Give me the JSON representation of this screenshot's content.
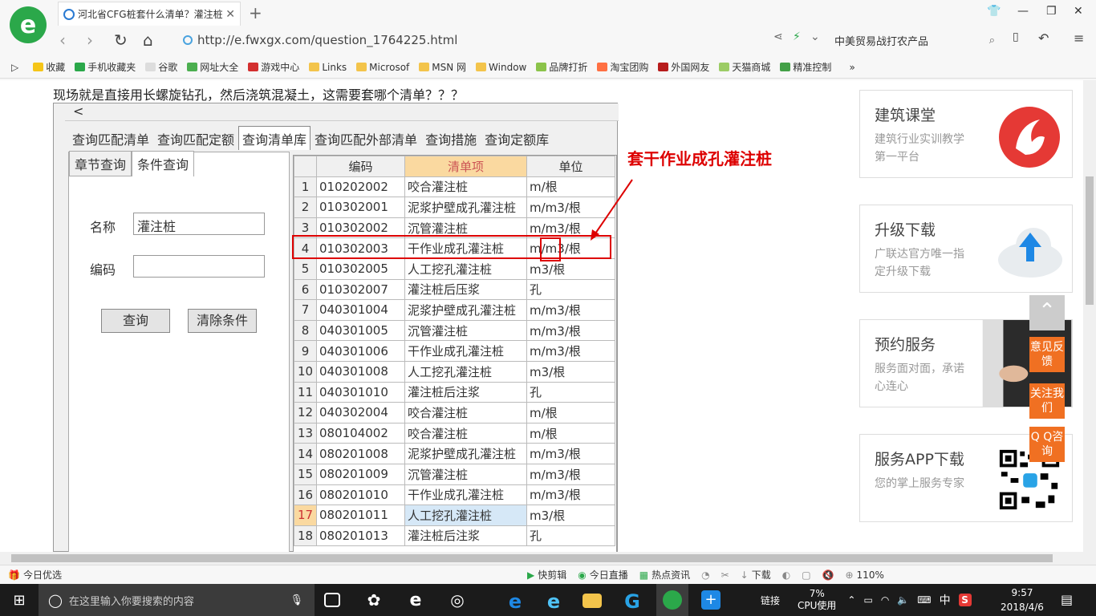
{
  "browser": {
    "tab_title": "河北省CFG桩套什么清单？灌注桩",
    "url": "http://e.fwxgx.com/question_1764225.html",
    "search_text": "中美贸易战打农产品",
    "bookmarks": [
      "收藏",
      "手机收藏夹",
      "谷歌",
      "网址大全",
      "游戏中心",
      "Links",
      "Microsof",
      "MSN 网",
      "Window",
      "品牌打折",
      "淘宝团购",
      "外国网友",
      "天猫商城",
      "精准控制"
    ]
  },
  "page": {
    "question": "现场就是直接用长螺旋钻孔，然后浇筑混凝土，这需要套哪个清单？？？",
    "annotation": "套干作业成孔灌注桩"
  },
  "software": {
    "back_btn": "<",
    "menu_tabs": [
      "查询匹配清单",
      "查询匹配定额",
      "查询清单库",
      "查询匹配外部清单",
      "查询措施",
      "查询定额库"
    ],
    "sub_tabs": [
      "章节查询",
      "条件查询"
    ],
    "name_label": "名称",
    "name_value": "灌注桩",
    "code_label": "编码",
    "code_value": "",
    "query_btn": "查询",
    "clear_btn": "清除条件",
    "headers": [
      "",
      "编码",
      "清单项",
      "单位"
    ],
    "rows": [
      [
        "1",
        "010202002",
        "咬合灌注桩",
        "m/根"
      ],
      [
        "2",
        "010302001",
        "泥浆护壁成孔灌注桩",
        "m/m3/根"
      ],
      [
        "3",
        "010302002",
        "沉管灌注桩",
        "m/m3/根"
      ],
      [
        "4",
        "010302003",
        "干作业成孔灌注桩",
        "m/m3/根"
      ],
      [
        "5",
        "010302005",
        "人工挖孔灌注桩",
        "m3/根"
      ],
      [
        "6",
        "010302007",
        "灌注桩后压浆",
        "孔"
      ],
      [
        "7",
        "040301004",
        "泥浆护壁成孔灌注桩",
        "m/m3/根"
      ],
      [
        "8",
        "040301005",
        "沉管灌注桩",
        "m/m3/根"
      ],
      [
        "9",
        "040301006",
        "干作业成孔灌注桩",
        "m/m3/根"
      ],
      [
        "10",
        "040301008",
        "人工挖孔灌注桩",
        "m3/根"
      ],
      [
        "11",
        "040301010",
        "灌注桩后注浆",
        "孔"
      ],
      [
        "12",
        "040302004",
        "咬合灌注桩",
        "m/根"
      ],
      [
        "13",
        "080104002",
        "咬合灌注桩",
        "m/根"
      ],
      [
        "14",
        "080201008",
        "泥浆护壁成孔灌注桩",
        "m/m3/根"
      ],
      [
        "15",
        "080201009",
        "沉管灌注桩",
        "m/m3/根"
      ],
      [
        "16",
        "080201010",
        "干作业成孔灌注桩",
        "m/m3/根"
      ],
      [
        "17",
        "080201011",
        "人工挖孔灌注桩",
        "m3/根"
      ],
      [
        "18",
        "080201013",
        "灌注桩后注浆",
        "孔"
      ]
    ]
  },
  "sidebar": {
    "cards": [
      {
        "title": "建筑课堂",
        "sub": "建筑行业实训教学第一平台"
      },
      {
        "title": "升级下载",
        "sub": "广联达官方唯一指定升级下载"
      },
      {
        "title": "预约服务",
        "sub": "服务面对面，承诺心连心"
      },
      {
        "title": "服务APP下载",
        "sub": "您的掌上服务专家"
      }
    ],
    "float_btns": [
      "意见反馈",
      "关注我们",
      "Q Q咨询"
    ]
  },
  "statusbar": {
    "left": "今日优选",
    "items": [
      "快剪辑",
      "今日直播",
      "热点资讯",
      "下载"
    ],
    "zoom": "110%"
  },
  "taskbar": {
    "search_placeholder": "在这里输入你要搜索的内容",
    "link": "链接",
    "cpu": "7%",
    "cpu_label": "CPU使用",
    "ime": "中",
    "time": "9:57",
    "date": "2018/4/6"
  },
  "colors": {
    "accent": "#f07022",
    "red": "#dd0000",
    "green": "#2ba84a"
  }
}
